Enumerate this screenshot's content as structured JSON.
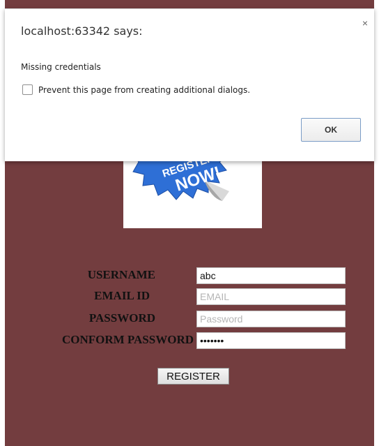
{
  "dialog": {
    "title": "localhost:63342 says:",
    "message": "Missing credentials",
    "prevent_label": "Prevent this page from creating additional dialogs.",
    "ok_label": "OK",
    "close_glyph": "×"
  },
  "banner": {
    "text_line1": "REGISTER",
    "text_line2": "NOW!",
    "badge_color": "#2e6fd6"
  },
  "form": {
    "username_label": "USERNAME",
    "username_value": "abc",
    "email_label": "EMAIL ID",
    "email_placeholder": "EMAIL",
    "password_label": "PASSWORD",
    "password_placeholder": "Password",
    "confirm_label": "CONFORM PASSWORD",
    "confirm_value": "•••••••",
    "register_label": "REGISTER"
  },
  "colors": {
    "page_background": "#733d3f"
  }
}
